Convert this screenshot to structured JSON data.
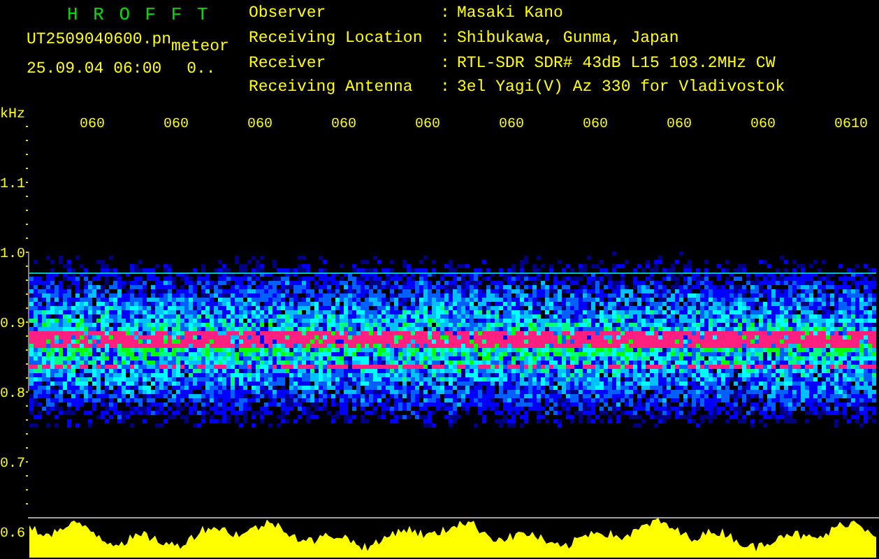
{
  "header": {
    "title": "H R O F F T",
    "file_name": "UT2509040600.pn",
    "mode": "meteor",
    "date_time": "25.09.04 06:00",
    "counter": "0..",
    "info": [
      {
        "label": "Observer",
        "separator": ":",
        "value": "Masaki Kano"
      },
      {
        "label": "Receiving Location",
        "separator": ":",
        "value": "Shibukawa, Gunma, Japan"
      },
      {
        "label": "Receiver",
        "separator": ":",
        "value": "RTL-SDR SDR# 43dB L15 103.2MHz CW"
      },
      {
        "label": "Receiving Antenna",
        "separator": ":",
        "value": "3el Yagi(V) Az 330 for Vladivostok"
      }
    ]
  },
  "plot": {
    "frequency_unit": "kHz",
    "time_labels": [
      "060",
      "060",
      "060",
      "060",
      "060",
      "060",
      "060",
      "060",
      "060",
      "0610"
    ],
    "frequency_labels": [
      "1.1",
      "1.0",
      "0.9",
      "0.8",
      "0.7",
      "0.6"
    ]
  }
}
